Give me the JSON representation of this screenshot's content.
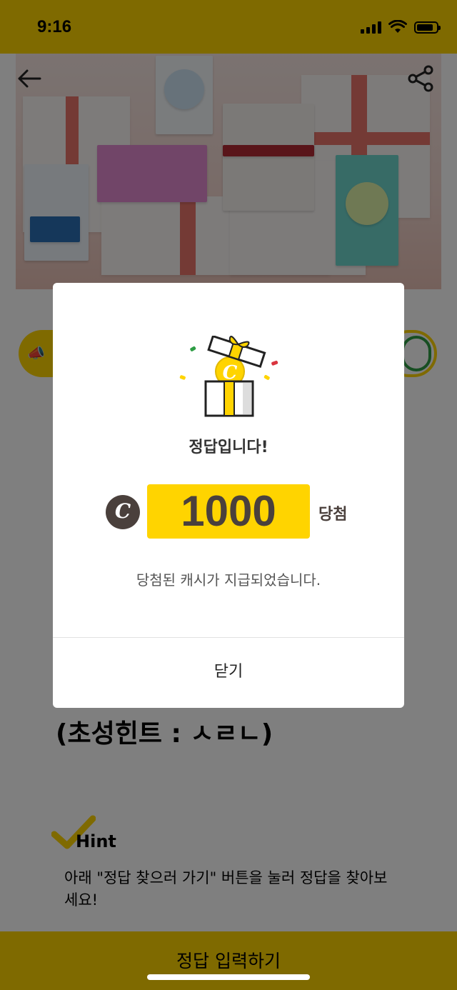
{
  "status": {
    "time": "9:16"
  },
  "hero": {
    "colors": {
      "ribbon": "#e8756a",
      "box_pink": "#e38bd0",
      "box_blue": "#cfe5f5",
      "box_teal": "#6fd6cd"
    }
  },
  "page": {
    "hint_title": "(초성힌트 : ㅅㄹㄴ)",
    "hint_label": "Hint",
    "hint_desc": "아래 \"정답 찾으러 가기\" 버튼을 눌러 정답을 찾아보세요!",
    "bottom_button": "정답 입력하기"
  },
  "modal": {
    "title": "정답입니다!",
    "coin_symbol": "C",
    "amount": "1000",
    "amount_suffix": "당첨",
    "description": "당첨된 캐시가 지급되었습니다.",
    "close_label": "닫기"
  },
  "colors": {
    "accent": "#ffd400",
    "coin": "#4a403c"
  }
}
